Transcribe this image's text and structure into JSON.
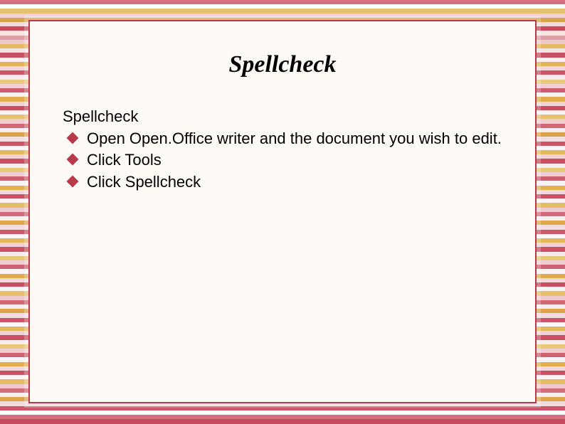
{
  "slide": {
    "title": "Spellcheck",
    "subheading": "Spellcheck",
    "bullets": [
      "Open Open.Office writer and the document you wish to edit.",
      "Click Tools",
      "Click Spellcheck"
    ]
  },
  "colors": {
    "accent": "#b8394a",
    "panel_bg": "#fdf9f5"
  },
  "stripes": [
    "#d46f7f",
    "#ffffff",
    "#e4c06f",
    "#f0d0d4",
    "#d9a54a",
    "#f3dadd",
    "#c94b5e",
    "#f5e7e0",
    "#dda0a9",
    "#eec9cd",
    "#e4b960",
    "#f4e1e3",
    "#c95062",
    "#fbeff0",
    "#e2b455",
    "#f2d6da",
    "#ca5668",
    "#f6ebec",
    "#e8c87a",
    "#efd1d5",
    "#cd5c6e",
    "#f9f0f1",
    "#e0ae4d",
    "#f1d4d8",
    "#c84e60",
    "#faf2f3",
    "#e6c070",
    "#eecdcf",
    "#d06575",
    "#f8edee",
    "#dba349",
    "#f3dde0",
    "#cb5466",
    "#fcf5f6",
    "#e4ba5e",
    "#f0d2d6",
    "#c94f61",
    "#f7ecee",
    "#e9c97c",
    "#efcfd3",
    "#ce5f70",
    "#faf1f2",
    "#e1b050",
    "#f2d8dc",
    "#c85163",
    "#fbf3f4",
    "#e5bd66",
    "#eecbd0",
    "#d26c7c",
    "#f9eeef",
    "#dda74c",
    "#f3dbde",
    "#cc5769",
    "#fcf6f7",
    "#e3b75a",
    "#f0d0d4",
    "#ca5264",
    "#f6eaec",
    "#e8c678",
    "#efcdd1",
    "#cf6272",
    "#faf2f3",
    "#e0ad4c",
    "#f2d7db",
    "#c95062",
    "#fbf4f5",
    "#e6bf6c",
    "#eec9ce",
    "#d16977",
    "#f8edee",
    "#dca54a",
    "#f3dcdf",
    "#cb5567",
    "#fcf7f8",
    "#e4b85c",
    "#f0d1d5",
    "#c94f61",
    "#f7ebec",
    "#e9c87a",
    "#efced2",
    "#ce6070",
    "#faf1f2",
    "#e1af4e",
    "#f2d8dc",
    "#c85164",
    "#fbf3f4",
    "#e5bc64",
    "#eecacf",
    "#d26b7b",
    "#f9eeef",
    "#dda64b",
    "#f3dadd",
    "#cc5668",
    "#ffffff",
    "#d46f7f",
    "#c84c5f"
  ]
}
